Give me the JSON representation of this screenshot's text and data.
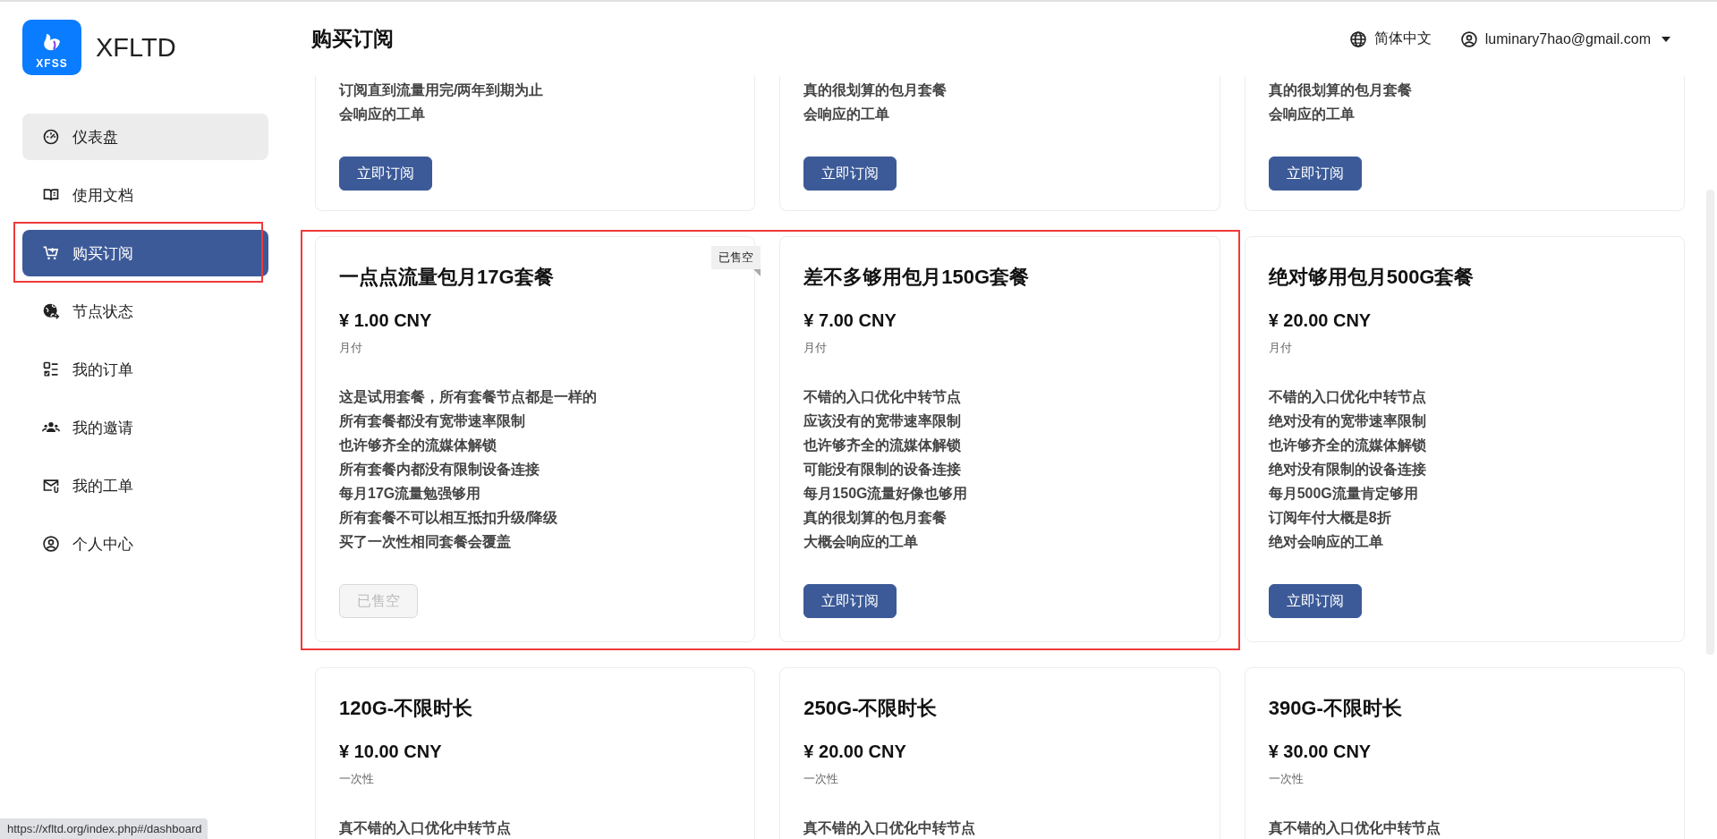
{
  "brand": {
    "logo_text": "XFSS",
    "name": "XFLTD"
  },
  "nav": [
    {
      "label": "仪表盘",
      "kind": "gauge",
      "selected": false,
      "hovered": true,
      "highlighted": false
    },
    {
      "label": "使用文档",
      "kind": "book",
      "selected": false,
      "hovered": false,
      "highlighted": false
    },
    {
      "label": "购买订阅",
      "kind": "cart",
      "selected": true,
      "hovered": false,
      "highlighted": true
    },
    {
      "label": "节点状态",
      "kind": "globe",
      "selected": false,
      "hovered": false,
      "highlighted": false
    },
    {
      "label": "我的订单",
      "kind": "checklist",
      "selected": false,
      "hovered": false,
      "highlighted": false
    },
    {
      "label": "我的邀请",
      "kind": "users",
      "selected": false,
      "hovered": false,
      "highlighted": false
    },
    {
      "label": "我的工单",
      "kind": "mail",
      "selected": false,
      "hovered": false,
      "highlighted": false
    },
    {
      "label": "个人中心",
      "kind": "user",
      "selected": false,
      "hovered": false,
      "highlighted": false
    }
  ],
  "header": {
    "title": "购买订阅",
    "language": "简体中文",
    "user_email": "luminary7hao@gmail.com"
  },
  "plan_rows": [
    {
      "cut_top": true,
      "cards": [
        {
          "features": [
            "订阅直到流量用完/两年到期为止",
            "会响应的工单"
          ],
          "button": {
            "label": "立即订阅",
            "disabled": false
          },
          "highlighted": false
        },
        {
          "features": [
            "真的很划算的包月套餐",
            "会响应的工单"
          ],
          "button": {
            "label": "立即订阅",
            "disabled": false
          },
          "highlighted": false
        },
        {
          "features": [
            "真的很划算的包月套餐",
            "会响应的工单"
          ],
          "button": {
            "label": "立即订阅",
            "disabled": false
          },
          "highlighted": false
        }
      ]
    },
    {
      "cut_top": false,
      "cards": [
        {
          "badge": "已售空",
          "title": "一点点流量包月17G套餐",
          "price": "¥ 1.00 CNY",
          "period": "月付",
          "features": [
            "这是试用套餐，所有套餐节点都是一样的",
            "所有套餐都没有宽带速率限制",
            "也许够齐全的流媒体解锁",
            "所有套餐内都没有限制设备连接",
            "每月17G流量勉强够用",
            "所有套餐不可以相互抵扣升级/降级",
            "买了一次性相同套餐会覆盖"
          ],
          "button": {
            "label": "已售空",
            "disabled": true
          },
          "highlighted": true
        },
        {
          "title": "差不多够用包月150G套餐",
          "price": "¥ 7.00 CNY",
          "period": "月付",
          "features": [
            "不错的入口优化中转节点",
            "应该没有的宽带速率限制",
            "也许够齐全的流媒体解锁",
            "可能没有限制的设备连接",
            "每月150G流量好像也够用",
            "真的很划算的包月套餐",
            "大概会响应的工单"
          ],
          "button": {
            "label": "立即订阅",
            "disabled": false
          },
          "highlighted": true
        },
        {
          "title": "绝对够用包月500G套餐",
          "price": "¥ 20.00 CNY",
          "period": "月付",
          "features": [
            "不错的入口优化中转节点",
            "绝对没有的宽带速率限制",
            "也许够齐全的流媒体解锁",
            "绝对没有限制的设备连接",
            "每月500G流量肯定够用",
            "订阅年付大概是8折",
            "绝对会响应的工单"
          ],
          "button": {
            "label": "立即订阅",
            "disabled": false
          },
          "highlighted": false
        }
      ]
    },
    {
      "cut_top": false,
      "cards": [
        {
          "title": "120G-不限时长",
          "price": "¥ 10.00 CNY",
          "period": "一次性",
          "features": [
            "真不错的入口优化中转节点"
          ],
          "highlighted": false
        },
        {
          "title": "250G-不限时长",
          "price": "¥ 20.00 CNY",
          "period": "一次性",
          "features": [
            "真不错的入口优化中转节点"
          ],
          "highlighted": false
        },
        {
          "title": "390G-不限时长",
          "price": "¥ 30.00 CNY",
          "period": "一次性",
          "features": [
            "真不错的入口优化中转节点"
          ],
          "highlighted": false
        }
      ]
    }
  ],
  "status_url": "https://xfltd.org/index.php#/dashboard"
}
